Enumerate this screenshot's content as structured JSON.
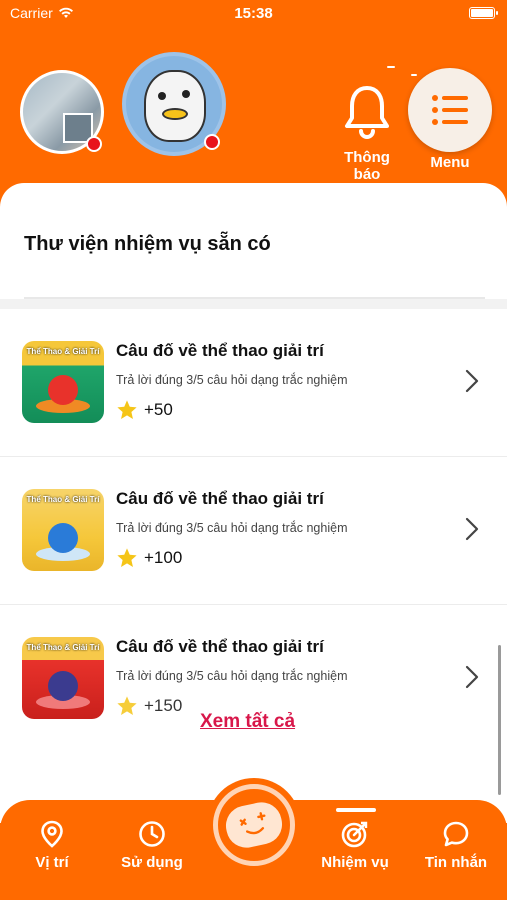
{
  "status_bar": {
    "carrier": "Carrier",
    "time": "15:38"
  },
  "header": {
    "notifications_label": "Thông báo",
    "menu_label": "Menu"
  },
  "library": {
    "title": "Thư viện nhiệm vụ sẵn có",
    "see_all": "Xem tất cả",
    "missions": [
      {
        "thumb_title": "Thể Thao & Giải Trí",
        "title": "Câu đố về thể thao giải trí",
        "description": "Trả lời đúng 3/5 câu hỏi dạng trắc nghiệm",
        "reward": "+50",
        "theme_color": "#1fa56a"
      },
      {
        "thumb_title": "Thể Thao & Giải Trí",
        "title": "Câu đố về thể thao giải trí",
        "description": "Trả lời đúng 3/5 câu hỏi dạng trắc nghiệm",
        "reward": "+100",
        "theme_color": "#f5c73a"
      },
      {
        "thumb_title": "Thể Thao & Giải Trí",
        "title": "Câu đố về thể thao giải trí",
        "description": "Trả lời đúng 3/5 câu hỏi dạng trắc nghiệm",
        "reward": "+150",
        "theme_color": "#e8322b"
      }
    ]
  },
  "bottom_nav": {
    "items": [
      {
        "label": "Vị trí",
        "icon": "location-pin-icon"
      },
      {
        "label": "Sử dụng",
        "icon": "clock-icon"
      },
      {
        "label": "Nhiệm vụ",
        "icon": "target-icon",
        "active": true
      },
      {
        "label": "Tin nhắn",
        "icon": "chat-bubble-icon"
      }
    ]
  },
  "colors": {
    "brand": "#ff6a00",
    "link": "#d8174a",
    "star": "#f5c518"
  }
}
